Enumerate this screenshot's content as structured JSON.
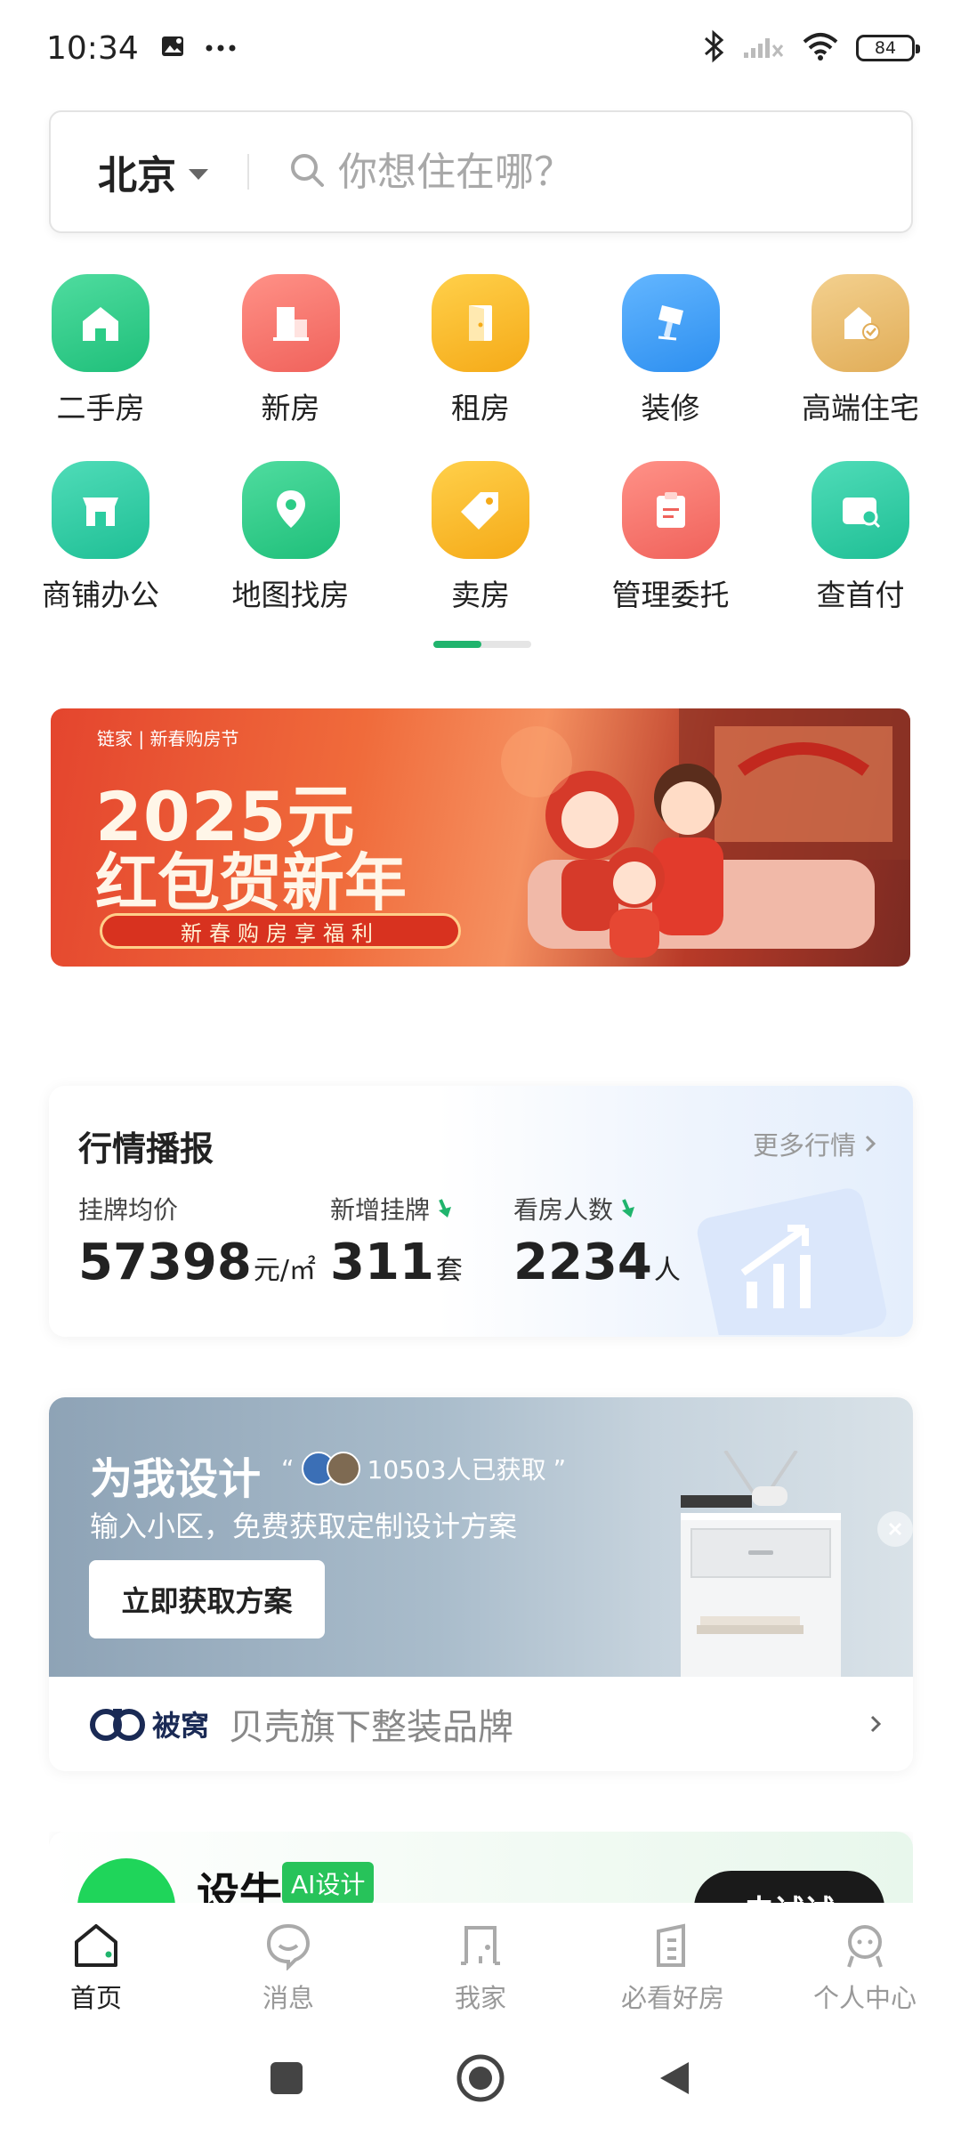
{
  "status_bar": {
    "time": "10:34",
    "battery": "84",
    "icons": [
      "image-icon",
      "more-dots-icon",
      "bluetooth-icon",
      "signal-icon",
      "wifi-icon",
      "battery-icon"
    ]
  },
  "search": {
    "city": "北京",
    "placeholder": "你想住在哪？"
  },
  "categories": [
    {
      "label": "二手房",
      "icon": "house-icon",
      "color": "#25c684"
    },
    {
      "label": "新房",
      "icon": "building-icon",
      "color": "#f4716a"
    },
    {
      "label": "租房",
      "icon": "door-icon",
      "color": "#f7b52a"
    },
    {
      "label": "装修",
      "icon": "brush-icon",
      "color": "#3d9df2"
    },
    {
      "label": "高端住宅",
      "icon": "luxury-house-icon",
      "color": "#e8bc6c"
    },
    {
      "label": "商铺办公",
      "icon": "shop-icon",
      "color": "#25c69b"
    },
    {
      "label": "地图找房",
      "icon": "map-pin-icon",
      "color": "#25c684"
    },
    {
      "label": "卖房",
      "icon": "tag-icon",
      "color": "#f7b52a"
    },
    {
      "label": "管理委托",
      "icon": "clipboard-icon",
      "color": "#f4716a"
    },
    {
      "label": "查首付",
      "icon": "wallet-search-icon",
      "color": "#25c69b"
    }
  ],
  "banner": {
    "brand": "链家 | 新春购房节",
    "title_line1": "2025元",
    "title_line2": "红包贺新年",
    "pill": "新春购房享福利"
  },
  "market": {
    "title": "行情播报",
    "more": "更多行情",
    "stats": [
      {
        "label": "挂牌均价",
        "value": "57398",
        "unit": "元/㎡",
        "trend": ""
      },
      {
        "label": "新增挂牌",
        "value": "311",
        "unit": "套",
        "trend": "down"
      },
      {
        "label": "看房人数",
        "value": "2234",
        "unit": "人",
        "trend": "down"
      }
    ]
  },
  "design": {
    "title": "为我设计",
    "count": "10503人已获取",
    "open_quote": "“",
    "close_quote": "”",
    "subtitle": "输入小区，免费获取定制设计方案",
    "button": "立即获取方案",
    "brand_name": "被窝",
    "brand_desc": "贝壳旗下整装品牌"
  },
  "ai_card": {
    "name": "设牛",
    "badge": "AI设计",
    "button": "去试试"
  },
  "tabs": [
    {
      "label": "首页",
      "icon": "home-icon",
      "active": true
    },
    {
      "label": "消息",
      "icon": "message-icon",
      "active": false
    },
    {
      "label": "我家",
      "icon": "my-home-icon",
      "active": false
    },
    {
      "label": "必看好房",
      "icon": "featured-house-icon",
      "active": false
    },
    {
      "label": "个人中心",
      "icon": "profile-icon",
      "active": false
    }
  ],
  "colors": {
    "accent": "#20b46d"
  }
}
